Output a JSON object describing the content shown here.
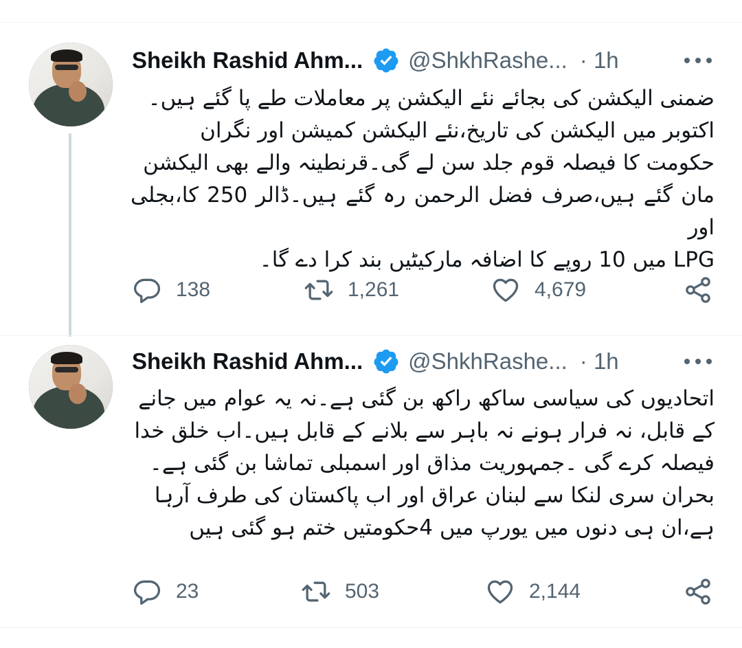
{
  "tweets": [
    {
      "author_name": "Sheikh Rashid Ahm...",
      "handle": "@ShkhRashe...",
      "time": "· 1h",
      "text": "ضمنی الیکشن کی بجائے نئے الیکشن پر معاملات طے پا گئے ہیں۔\nاکتوبر میں الیکشن کی تاریخ،نئے الیکشن کمیشن اور نگران\nحکومت کا فیصلہ قوم جلد سن لے گی۔قرنطینہ والے بھی الیکشن\nمان گئے ہیں،صرف فضل الرحمن رہ گئے ہیں۔ڈالر 250 کا،بجلی اور\nLPG میں 10 روپے کا اضافہ مارکیٹیں بند کرا دے گا۔",
      "replies": "138",
      "retweets": "1,261",
      "likes": "4,679"
    },
    {
      "author_name": "Sheikh Rashid Ahm...",
      "handle": "@ShkhRashe...",
      "time": "· 1h",
      "text": "اتحادیوں کی سیاسی ساکھ راکھ بن گئی ہے۔نہ یہ عوام میں جانے\nکے قابل، نہ فرار ہونے نہ باہر سے بلانے کے قابل ہیں۔اب خلق خدا\nفیصلہ کرے گی ۔جمہوریت مذاق اور اسمبلی تماشا بن گئی ہے۔\nبحران سری لنکا سے لبنان عراق اور اب پاکستان کی طرف آرہا\nہے،ان ہی دنوں میں یورپ میں 4حکومتیں ختم ہو گئی ہیں",
      "replies": "23",
      "retweets": "503",
      "likes": "2,144"
    }
  ],
  "icons": {
    "verified": "verified-badge-icon",
    "reply": "reply-icon",
    "retweet": "retweet-icon",
    "like": "heart-icon",
    "share": "share-icon",
    "more": "more-icon"
  },
  "colors": {
    "verified": "#1d9bf0",
    "secondary_text": "#536471",
    "thread_line": "#cfd9de"
  }
}
